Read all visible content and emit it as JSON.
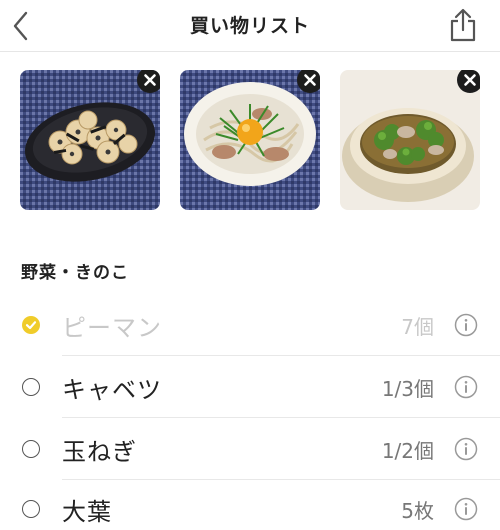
{
  "header": {
    "title": "買い物リスト",
    "back_icon": "chevron-left-icon",
    "share_icon": "share-icon"
  },
  "recipes": [
    {
      "name": "recipe-photo-lotus-root-hijiki",
      "remove_icon": "close-icon"
    },
    {
      "name": "recipe-photo-egg-yolk-noodles",
      "remove_icon": "close-icon"
    },
    {
      "name": "recipe-photo-broccoli-soup",
      "remove_icon": "close-icon"
    }
  ],
  "section": {
    "title": "野菜・きのこ"
  },
  "items": [
    {
      "name": "ピーマン",
      "quantity": "7個",
      "checked": true
    },
    {
      "name": "キャベツ",
      "quantity": "1/3個",
      "checked": false
    },
    {
      "name": "玉ねぎ",
      "quantity": "1/2個",
      "checked": false
    },
    {
      "name": "大葉",
      "quantity": "5枚",
      "checked": false
    }
  ],
  "colors": {
    "accent": "#f0cc2a",
    "text": "#222222",
    "muted": "#777777",
    "disabled": "#c8c8c8"
  }
}
